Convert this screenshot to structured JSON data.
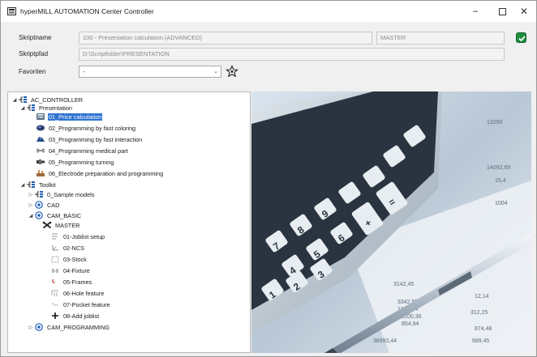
{
  "window": {
    "title": "hyperMILL AUTOMATION Center Controller",
    "buttons": {
      "minimize": "−",
      "close": "✕"
    }
  },
  "form": {
    "script_name_label": "Skriptname",
    "script_name_value": "100 - Presentation calculation (ADVANCED)",
    "mode_value": "MASTER",
    "script_path_label": "Skriptpfad",
    "script_path_value": "D:\\Scriptfolder\\PRESENTATION",
    "favorites_label": "Favoriten",
    "favorites_value": "-"
  },
  "tree": {
    "root": "AC_CONTROLLER",
    "presentation": {
      "label": "Presentation",
      "items": [
        "01_Price calculation",
        "02_Programming by fast coloring",
        "03_Programming by fast interaction",
        "04_Programming medical part",
        "05_Programming turning",
        "06_Electrode preparation and programming"
      ]
    },
    "toolkit": {
      "label": "Toolkit",
      "sample_models": "0_Sample models",
      "cad": "CAD",
      "cam_basic": {
        "label": "CAM_BASIC",
        "items": [
          "MASTER",
          "01-Joblist setup",
          "02-NCS",
          "03-Stock",
          "04-Fixture",
          "05-Frames",
          "06-Hole feature",
          "07-Pocket feature",
          "08-Add joblist"
        ]
      },
      "cam_programming": "CAM_PROGRAMMING"
    }
  },
  "image": {
    "description_icon": "calculator-and-pen-photo",
    "figures": [
      "15,4",
      "1004",
      "3142,45",
      "3342,55",
      "1352,14",
      "8-2100,36",
      "854,94",
      "38992,44",
      "13290",
      "14092,69",
      "12,14",
      "312,25",
      "874,48",
      "689,45"
    ]
  },
  "colors": {
    "selection": "#2e73d1",
    "ok_green": "#1e8e3e"
  }
}
